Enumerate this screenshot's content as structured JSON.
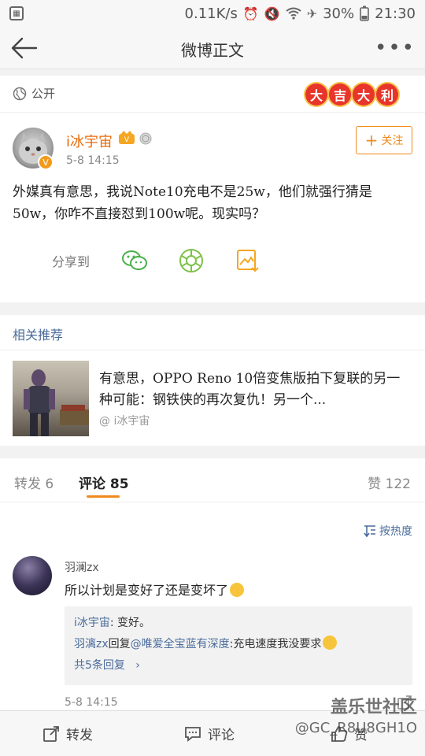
{
  "statusbar": {
    "speed": "0.11K/s",
    "battery": "30%",
    "time": "21:30",
    "icons": [
      "alarm-icon",
      "mute-icon",
      "wifi-icon",
      "airplane-icon",
      "battery-icon"
    ]
  },
  "navbar": {
    "title": "微博正文",
    "back_icon": "back-arrow-icon",
    "more_icon": "more-dots-icon"
  },
  "post": {
    "visibility": "公开",
    "badge": [
      "大",
      "吉",
      "大",
      "利"
    ],
    "author": "i冰宇宙",
    "time": "5-8 14:15",
    "follow_label": "关注",
    "text": "外媒真有意思，我说Note10充电不是25w，他们就强行猜是50w，你咋不直接怼到100w呢。现实吗？",
    "share_label": "分享到",
    "share_icons": [
      "wechat-icon",
      "moments-icon",
      "save-image-icon"
    ]
  },
  "recommend": {
    "title": "相关推荐",
    "item_text": "有意思，OPPO Reno 10倍变焦版拍下复联的另一种可能：钢铁侠的再次复仇！另一个...",
    "item_author": "@ i冰宇宙"
  },
  "tabs": {
    "repost": "转发 6",
    "comment_label": "评论",
    "comment_count": "85",
    "like": "赞 122"
  },
  "sort_label": "按热度",
  "comment": {
    "name": "羽澜zx",
    "text": "所以计划是变好了还是变坏了",
    "reply1_name": "i冰宇宙",
    "reply1_text": ": 变好。",
    "reply2_name": "羽漓zx",
    "reply2_mid": "回复",
    "reply2_mention": "@唯爱全宝蓝有深度",
    "reply2_text": ":充电速度我没要求",
    "more_replies": "共5条回复",
    "time": "5-8 14:15"
  },
  "bottombar": {
    "repost": "转发",
    "comment": "评论",
    "like": "赞"
  },
  "watermark": {
    "line1": "盖乐世社区",
    "line2": "@GC_R8U8GH1O"
  },
  "colors": {
    "accent_orange": "#f08a1d",
    "link_blue": "#4a6c9b",
    "username_orange": "#e86b0b"
  }
}
